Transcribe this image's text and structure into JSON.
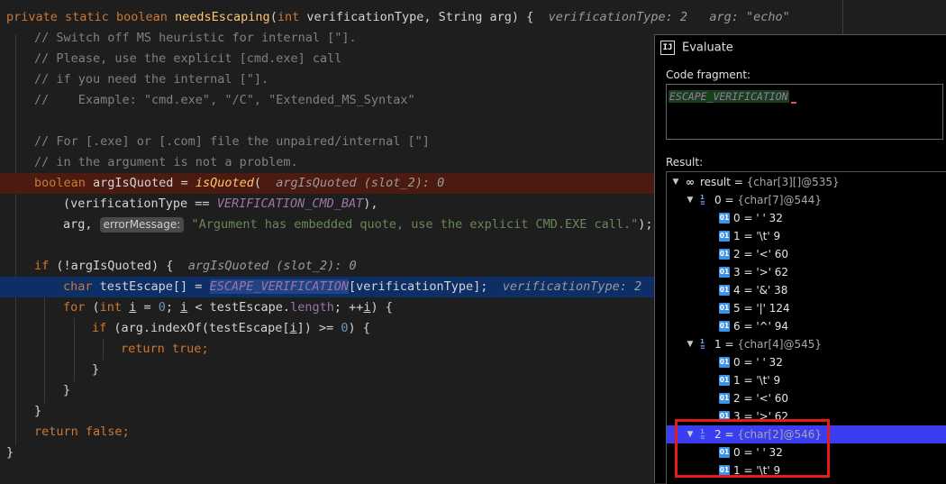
{
  "editor": {
    "signature": {
      "kw_private": "private",
      "kw_static": "static",
      "kw_boolean": "boolean",
      "method": "needsEscaping",
      "paren_open": "(",
      "kw_int": "int",
      "param1": " verificationType, String arg) {",
      "hint": "verificationType: 2   arg: \"echo\""
    },
    "comments": [
      "// Switch off MS heuristic for internal [\"].",
      "// Please, use the explicit [cmd.exe] call",
      "// if you need the internal [\"].",
      "//    Example: \"cmd.exe\", \"/C\", \"Extended_MS_Syntax\"",
      "// For [.exe] or [.com] file the unpaired/internal [\"]",
      "// in the argument is not a problem."
    ],
    "line_arg": {
      "kw": "boolean",
      "var": " argIsQuoted = ",
      "fn": "isQuoted",
      "paren": "(",
      "hint": "argIsQuoted (slot_2): 0"
    },
    "line_vt": {
      "open": "(verificationType == ",
      "const": "VERIFICATION_CMD_BAT",
      "close": "),"
    },
    "line_msg": {
      "prefix": "arg, ",
      "badge": "errorMessage:",
      "string": "\"Argument has embedded quote, use the explicit CMD.EXE call.\"",
      "suffix": ");"
    },
    "line_if": {
      "kw": "if",
      "cond": " (!argIsQuoted) {",
      "hint": "argIsQuoted (slot_2): 0"
    },
    "line_char": {
      "kw": "char",
      "decl": " testEscape[] = ",
      "const": "ESCAPE_VERIFICATION",
      "index": "[verificationType];",
      "hint": "verificationType: 2"
    },
    "line_for": {
      "kw_for": "for",
      "p1": " (",
      "kw_int": "int",
      "sp": " ",
      "i1": "i",
      "eq": " = ",
      "zero": "0",
      "semi": "; ",
      "i2": "i",
      "lt": " < testEscape.",
      "len": "length",
      "inc": "; ++",
      "i3": "i",
      "close": ") {"
    },
    "line_inner_if": {
      "kw": "if",
      "a": " (arg.indexOf(testEscape[",
      "i": "i",
      "b": "]) >= ",
      "zero": "0",
      "c": ") {"
    },
    "return_true": {
      "kw": "return",
      "val": "true",
      "semi": ";"
    },
    "brace_close": "}",
    "return_false": {
      "kw": "return",
      "val": "false",
      "semi": ";"
    }
  },
  "evaluate": {
    "title": "Evaluate",
    "logo": "IJ",
    "code_fragment_label": "Code fragment:",
    "code_fragment_value": "ESCAPE_VERIFICATION",
    "result_label": "Result:",
    "tree": [
      {
        "indent": 0,
        "arrow": "▼",
        "icon": "result",
        "name": "result",
        "sep": " = ",
        "type": "{char[3][]@535}",
        "selected": false
      },
      {
        "indent": 1,
        "arrow": "▼",
        "icon": "array",
        "name": "0",
        "sep": " = ",
        "type": "{char[7]@544}",
        "selected": false
      },
      {
        "indent": 2,
        "arrow": "",
        "icon": "01",
        "name": "0",
        "sep": " = ",
        "value": "' ' 32",
        "selected": false
      },
      {
        "indent": 2,
        "arrow": "",
        "icon": "01",
        "name": "1",
        "sep": " = ",
        "value": "'\\t' 9",
        "selected": false
      },
      {
        "indent": 2,
        "arrow": "",
        "icon": "01",
        "name": "2",
        "sep": " = ",
        "value": "'<' 60",
        "selected": false
      },
      {
        "indent": 2,
        "arrow": "",
        "icon": "01",
        "name": "3",
        "sep": " = ",
        "value": "'>' 62",
        "selected": false
      },
      {
        "indent": 2,
        "arrow": "",
        "icon": "01",
        "name": "4",
        "sep": " = ",
        "value": "'&' 38",
        "selected": false
      },
      {
        "indent": 2,
        "arrow": "",
        "icon": "01",
        "name": "5",
        "sep": " = ",
        "value": "'|' 124",
        "selected": false
      },
      {
        "indent": 2,
        "arrow": "",
        "icon": "01",
        "name": "6",
        "sep": " = ",
        "value": "'^' 94",
        "selected": false
      },
      {
        "indent": 1,
        "arrow": "▼",
        "icon": "array",
        "name": "1",
        "sep": " = ",
        "type": "{char[4]@545}",
        "selected": false
      },
      {
        "indent": 2,
        "arrow": "",
        "icon": "01",
        "name": "0",
        "sep": " = ",
        "value": "' ' 32",
        "selected": false
      },
      {
        "indent": 2,
        "arrow": "",
        "icon": "01",
        "name": "1",
        "sep": " = ",
        "value": "'\\t' 9",
        "selected": false
      },
      {
        "indent": 2,
        "arrow": "",
        "icon": "01",
        "name": "2",
        "sep": " = ",
        "value": "'<' 60",
        "selected": false
      },
      {
        "indent": 2,
        "arrow": "",
        "icon": "01",
        "name": "3",
        "sep": " = ",
        "value": "'>' 62",
        "selected": false
      },
      {
        "indent": 1,
        "arrow": "▼",
        "icon": "array",
        "name": "2",
        "sep": " = ",
        "type": "{char[2]@546}",
        "selected": true
      },
      {
        "indent": 2,
        "arrow": "",
        "icon": "01",
        "name": "0",
        "sep": " = ",
        "value": "' ' 32",
        "selected": false
      },
      {
        "indent": 2,
        "arrow": "",
        "icon": "01",
        "name": "1",
        "sep": " = ",
        "value": "'\\t' 9",
        "selected": false
      }
    ]
  }
}
